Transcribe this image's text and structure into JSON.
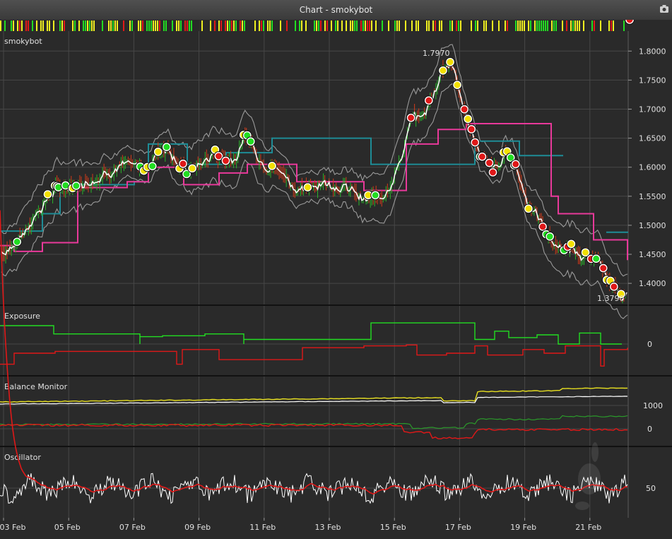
{
  "window": {
    "title": "Chart - smokybot"
  },
  "icons": {
    "camera": "camera-icon"
  },
  "panels": {
    "price": {
      "label": "smokybot",
      "high_label": "1.7970",
      "low_label": "1.3790",
      "ticks": [
        "1.8000",
        "1.7500",
        "1.7000",
        "1.6500",
        "1.6000",
        "1.5500",
        "1.5000",
        "1.4500",
        "1.4000"
      ]
    },
    "exposure": {
      "label": "Exposure",
      "ticks": [
        "0"
      ]
    },
    "balance": {
      "label": "Balance Monitor",
      "ticks": [
        "1000",
        "0"
      ]
    },
    "oscillator": {
      "label": "Oscillator",
      "ticks": [
        "50"
      ]
    }
  },
  "x_axis": {
    "dates": [
      "03 Feb",
      "05 Feb",
      "07 Feb",
      "09 Feb",
      "11 Feb",
      "13 Feb",
      "15 Feb",
      "17 Feb",
      "19 Feb",
      "21 Feb"
    ]
  },
  "colors": {
    "background": "#2a2a2a",
    "grid": "#474747",
    "price_line": "#ffffff",
    "band": "#9a9a9a",
    "upper_step": "#1e8c96",
    "lower_step": "#e8399a",
    "long": "#22dd22",
    "short": "#e01818",
    "balance_yellow": "#e8e020",
    "balance_white": "#ffffff",
    "balance_green": "#2a9a2a",
    "balance_red": "#e01818",
    "osc_white": "#ffffff",
    "osc_red": "#e01818"
  },
  "chart_data": {
    "type": "line",
    "title": "smokybot",
    "x": [
      "03 Feb",
      "05 Feb",
      "07 Feb",
      "09 Feb",
      "11 Feb",
      "13 Feb",
      "15 Feb",
      "17 Feb",
      "19 Feb",
      "21 Feb"
    ],
    "ylim": [
      1.37,
      1.81
    ],
    "series": [
      {
        "values": [
          1.455,
          1.565,
          1.6,
          1.595,
          1.61,
          1.575,
          1.56,
          1.71,
          1.59,
          1.46,
          1.379
        ]
      }
    ],
    "annotations": [
      "1.7970",
      "1.3790"
    ]
  }
}
